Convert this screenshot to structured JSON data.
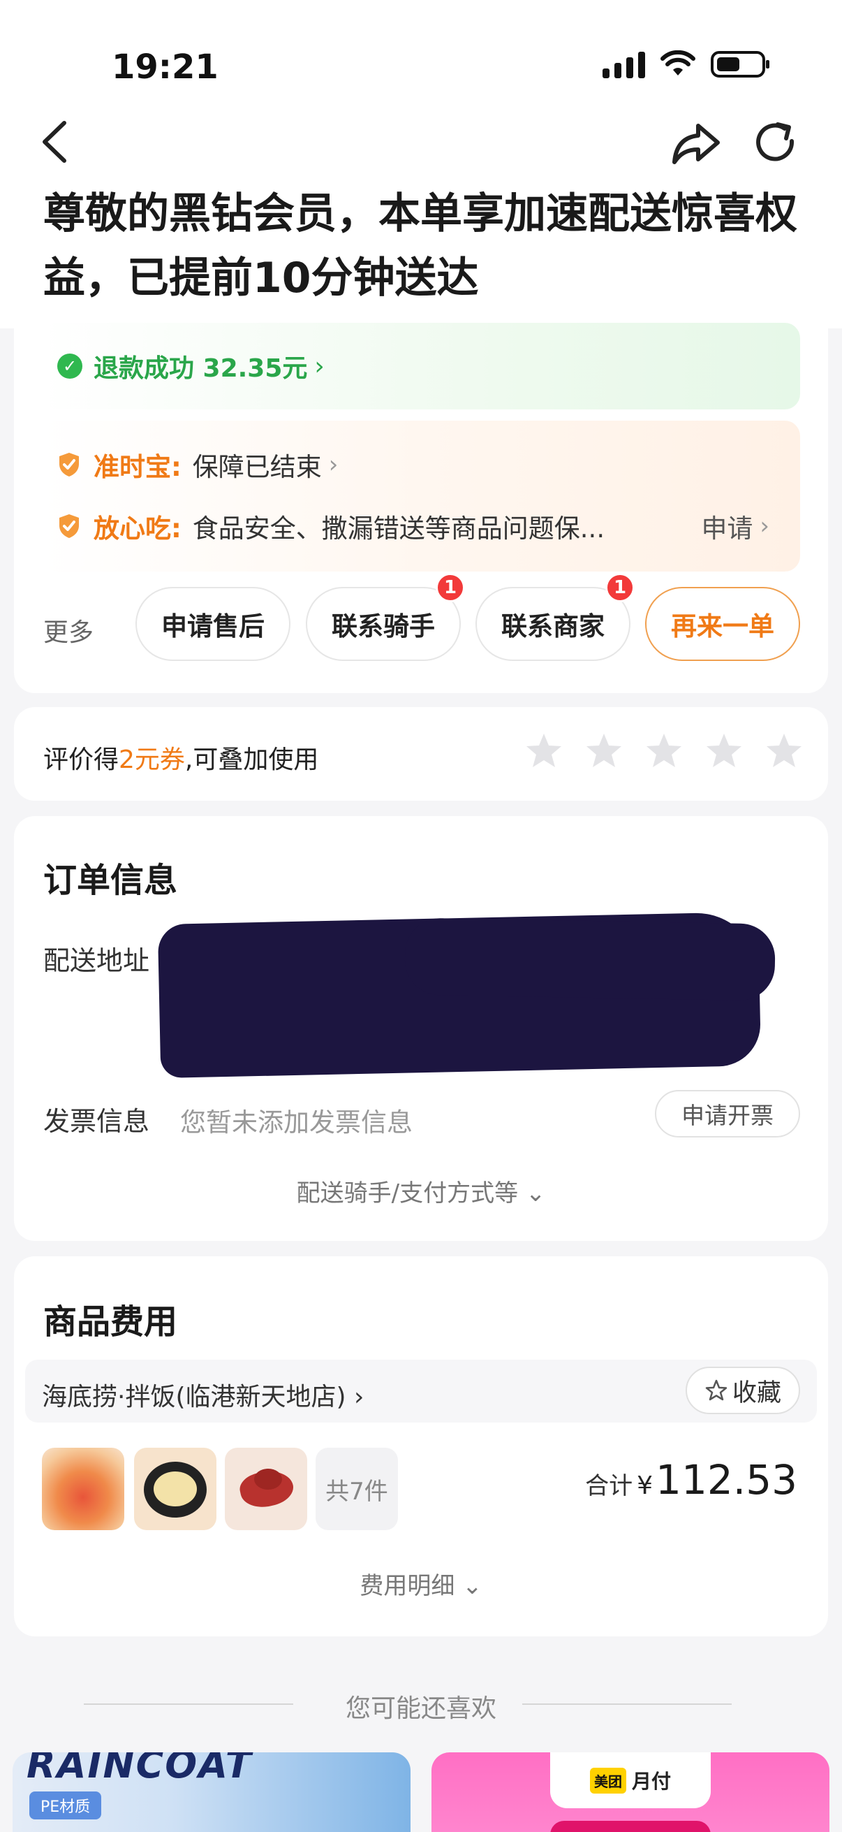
{
  "status_bar": {
    "time": "19:21"
  },
  "nav": {
    "back": "back-icon",
    "share": "share-icon",
    "refresh": "refresh-icon"
  },
  "headline": "尊敬的黑钻会员，本单享加速配送惊喜权益，已提前10分钟送达",
  "refund": {
    "text": "退款成功 32.35元",
    "arrow": "›"
  },
  "guarantees": [
    {
      "label": "准时宝:",
      "value": "保障已结束",
      "arrow": "›"
    },
    {
      "label": "放心吃:",
      "value": "食品安全、撒漏错送等商品问题保...",
      "action": "申请",
      "arrow": "›"
    }
  ],
  "actions": {
    "more": "更多",
    "buttons": [
      {
        "label": "申请售后",
        "badge": ""
      },
      {
        "label": "联系骑手",
        "badge": "1"
      },
      {
        "label": "联系商家",
        "badge": "1"
      },
      {
        "label": "再来一单",
        "badge": ""
      }
    ]
  },
  "rating": {
    "prefix": "评价得",
    "highlight": "2元券",
    "suffix": ",可叠加使用",
    "stars": 5
  },
  "order_info": {
    "title": "订单信息",
    "address_label": "配送地址",
    "address_lines": [
      "",
      "",
      ""
    ],
    "invoice_label": "发票信息",
    "invoice_hint": "您暂未添加发票信息",
    "invoice_button": "申请开票",
    "expand": "配送骑手/支付方式等 ⌄"
  },
  "goods": {
    "title": "商品费用",
    "shop_name": "海底捞·拌饭(临港新天地店) ›",
    "favorite": "收藏",
    "count_label": "共7件",
    "total_label": "合计",
    "currency": "¥",
    "total": "112.53",
    "expand": "费用明细 ⌄"
  },
  "recommend": {
    "title": "您可能还喜欢",
    "card1_brand": "RAINCOAT",
    "card1_tag": "PE材质",
    "card2_logo": "美团",
    "card2_text": "月付"
  },
  "colors": {
    "accent": "#f07a16",
    "success": "#2aa64a",
    "badge": "#f23a3a"
  }
}
